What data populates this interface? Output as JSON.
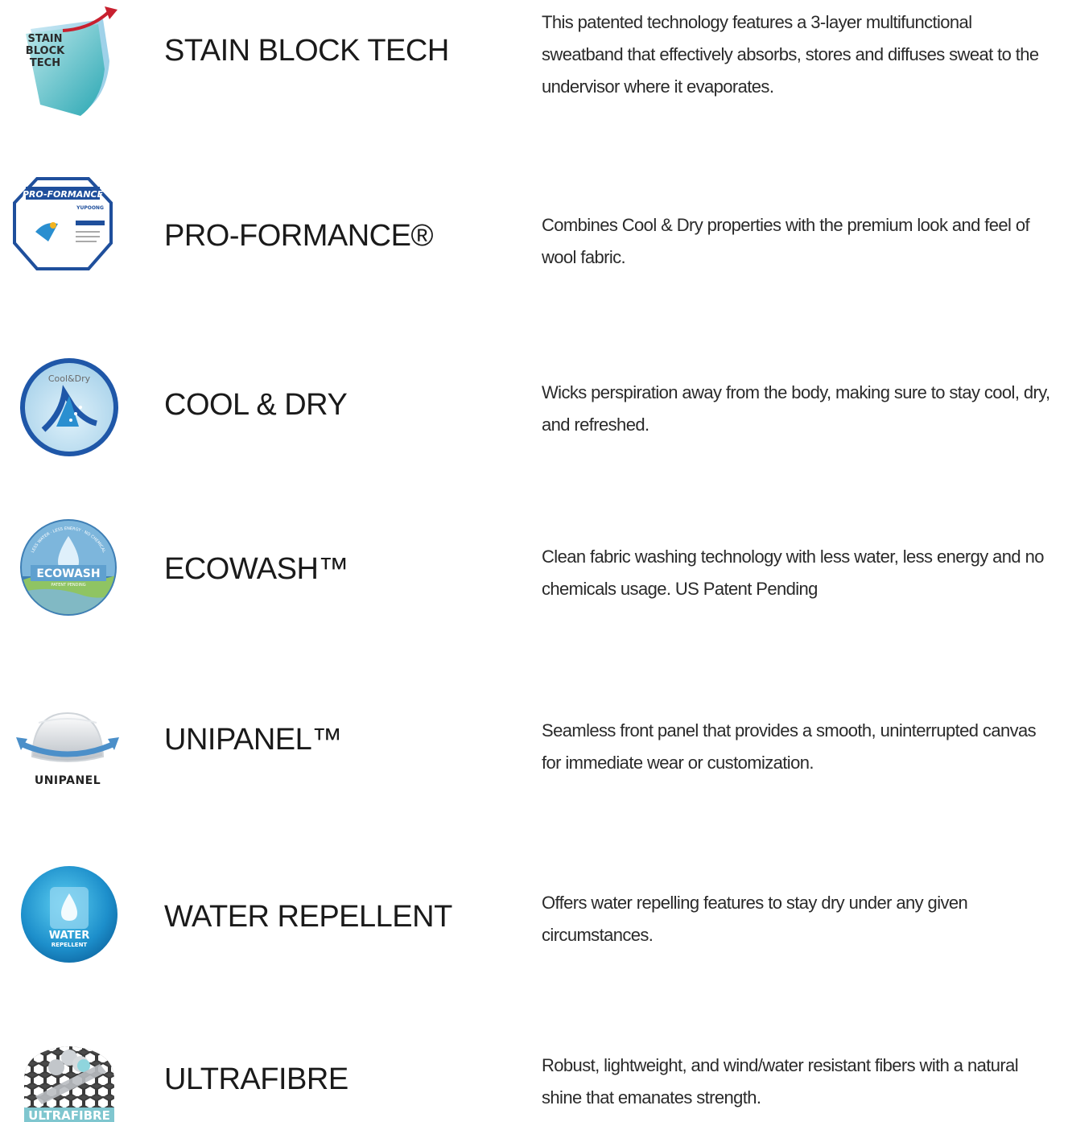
{
  "features": [
    {
      "icon": "stain-block-tech-logo",
      "logo_text": [
        "STAIN",
        "BLOCK",
        "TECH"
      ],
      "title": "STAIN BLOCK TECH",
      "description": "This patented technology features a 3-layer multifunctional sweatband that effectively absorbs, stores and diffuses sweat to the undervisor where it evaporates."
    },
    {
      "icon": "pro-formance-logo",
      "logo_text": [
        "PRO-FORMANCE",
        "YUPOONG"
      ],
      "title": "PRO-FORMANCE®",
      "description": "Combines Cool & Dry properties with the premium look and feel of wool fabric."
    },
    {
      "icon": "cool-and-dry-logo",
      "logo_text": [
        "Cool&Dry"
      ],
      "title": "COOL & DRY",
      "description": "Wicks perspiration away from the body, making sure to stay cool, dry, and refreshed."
    },
    {
      "icon": "ecowash-logo",
      "logo_text": [
        "ECOWASH",
        "PATENT PENDING",
        "LESS WATER · LESS ENERGY · NO CHEMICAL"
      ],
      "title": "ECOWASH™",
      "description": "Clean fabric washing technology with less water, less energy and no chemicals usage. US Patent Pending"
    },
    {
      "icon": "unipanel-logo",
      "logo_text": [
        "UNIPANEL"
      ],
      "title": "UNIPANEL™",
      "description": "Seamless front panel that provides a smooth, uninterrupted canvas for immediate wear or customization."
    },
    {
      "icon": "water-repellent-logo",
      "logo_text": [
        "WATER",
        "REPELLENT"
      ],
      "title": "WATER REPELLENT",
      "description": "Offers water repelling features to stay dry under any given circumstances."
    },
    {
      "icon": "ultrafibre-logo",
      "logo_text": [
        "ULTRAFIBRE"
      ],
      "title": "ULTRAFIBRE",
      "description": "Robust, lightweight, and wind/water resistant fibers with a natural shine that emanates strength."
    }
  ],
  "colors": {
    "text": "#1a1a1a",
    "brand_blue": "#1f4f9c",
    "teal": "#4fc1c9",
    "sky": "#2a8fd0",
    "red_arrow": "#c8202f"
  }
}
